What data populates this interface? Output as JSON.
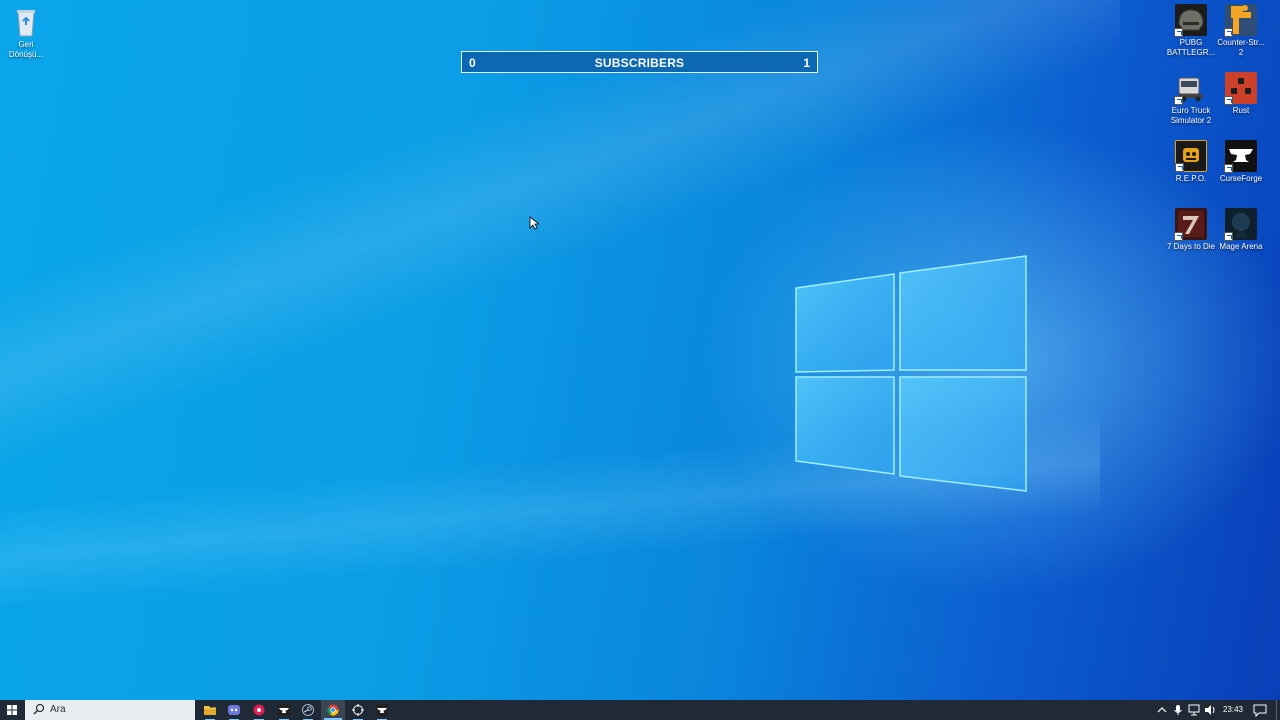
{
  "overlay": {
    "subscriber_goal": {
      "start_value": "0",
      "label": "SUBSCRIBERS",
      "goal_value": "1",
      "progress_fraction": 0
    }
  },
  "desktop": {
    "left_icons": [
      {
        "label": "Geri\nDönüşü...",
        "icon": "recycle-bin-icon"
      }
    ],
    "right_icons": [
      {
        "label": "PUBG BATTLEGR...",
        "icon": "pubg-icon"
      },
      {
        "label": "Counter-Str... 2",
        "icon": "counter-strike-2-icon"
      },
      {
        "label": "Euro Truck Simulator 2",
        "icon": "euro-truck-simulator-2-icon"
      },
      {
        "label": "Rust",
        "icon": "rust-icon"
      },
      {
        "label": "R.E.P.O.",
        "icon": "repo-icon"
      },
      {
        "label": "CurseForge",
        "icon": "curseforge-icon"
      },
      {
        "label": "7 Days to Die",
        "icon": "7-days-to-die-icon"
      },
      {
        "label": "Mage Arena",
        "icon": "mage-arena-icon"
      }
    ]
  },
  "taskbar": {
    "search_placeholder": "Ara",
    "apps": [
      {
        "name": "file-explorer",
        "icon": "folder-icon"
      },
      {
        "name": "discord",
        "icon": "discord-icon"
      },
      {
        "name": "recorder",
        "icon": "record-icon"
      },
      {
        "name": "curseforge-app",
        "icon": "curseforge-small-icon"
      },
      {
        "name": "steam",
        "icon": "steam-icon"
      },
      {
        "name": "chrome",
        "icon": "chrome-icon"
      },
      {
        "name": "crosshair-app",
        "icon": "crosshair-icon"
      },
      {
        "name": "curseforge-app-2",
        "icon": "curseforge-small-icon"
      }
    ],
    "clock": "23:43"
  },
  "colors": {
    "taskbar": "#1f2a36",
    "subbar_bg": "#0c68b2",
    "wallpaper_blue": "#0a9be6"
  }
}
